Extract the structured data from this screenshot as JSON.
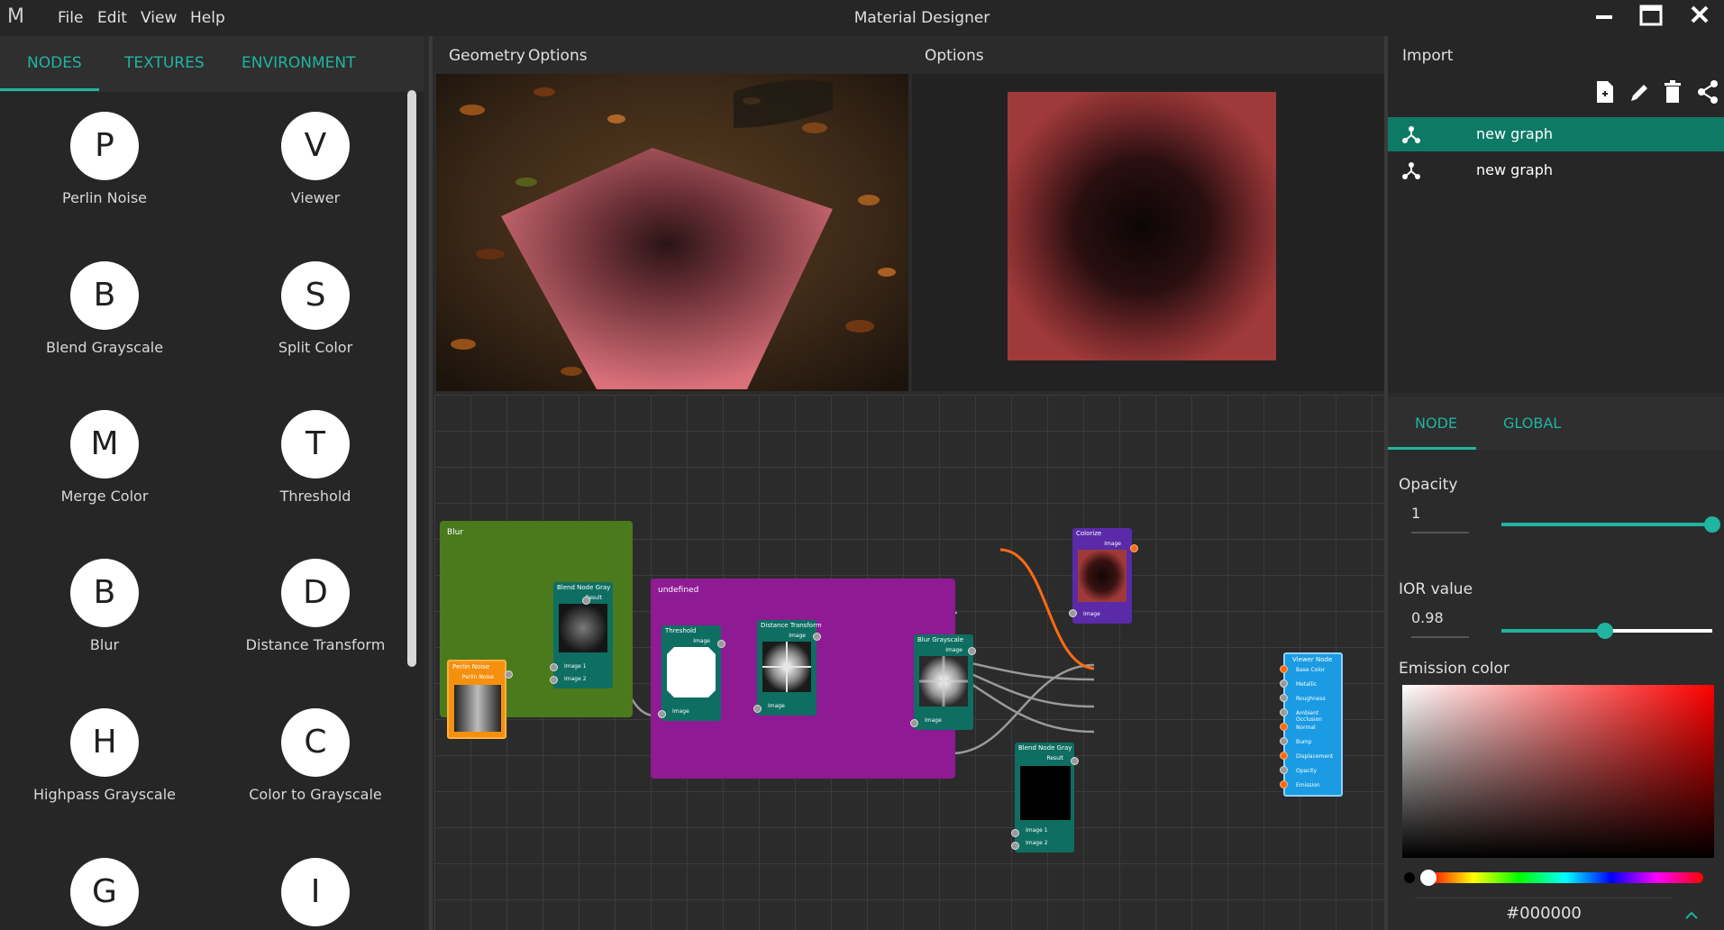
{
  "app": {
    "logo": "M",
    "title": "Material Designer"
  },
  "menu": [
    "File",
    "Edit",
    "View",
    "Help"
  ],
  "window_controls": {
    "minimize": "minimize-icon",
    "maximize": "maximize-icon",
    "close": "close-icon"
  },
  "left_tabs": [
    "NODES",
    "TEXTURES",
    "ENVIRONMENT"
  ],
  "nodes": [
    {
      "letter": "P",
      "label": "Perlin Noise"
    },
    {
      "letter": "V",
      "label": "Viewer"
    },
    {
      "letter": "B",
      "label": "Blend Grayscale"
    },
    {
      "letter": "S",
      "label": "Split Color"
    },
    {
      "letter": "M",
      "label": "Merge Color"
    },
    {
      "letter": "T",
      "label": "Threshold"
    },
    {
      "letter": "B",
      "label": "Blur"
    },
    {
      "letter": "D",
      "label": "Distance Transform"
    },
    {
      "letter": "H",
      "label": "Highpass Grayscale"
    },
    {
      "letter": "C",
      "label": "Color to Grayscale"
    },
    {
      "letter": "G",
      "label": ""
    },
    {
      "letter": "I",
      "label": ""
    }
  ],
  "view3d_bar": [
    "Geometry",
    "Options"
  ],
  "view2d_bar": [
    "Options"
  ],
  "graph": {
    "frames": [
      {
        "title": "Blur",
        "color": "#4a7a1c"
      },
      {
        "title": "undefined",
        "color": "#8e1a94"
      }
    ],
    "nodes": [
      {
        "title": "Blend Node Gray",
        "out": "Result",
        "inputs": [
          "Image 1",
          "Image 2"
        ]
      },
      {
        "title": "Perlin Noise",
        "out": "Perlin Noise",
        "inputs": []
      },
      {
        "title": "Threshold",
        "out": "Image",
        "inputs": [
          "Image"
        ]
      },
      {
        "title": "Distance Transform",
        "out": "Image",
        "inputs": [
          "Image"
        ]
      },
      {
        "title": "Blur Grayscale",
        "out": "Image",
        "inputs": [
          "Image"
        ]
      },
      {
        "title": "Colorize",
        "out": "Image",
        "inputs": [
          "Image"
        ]
      },
      {
        "title": "Blend Node Gray",
        "out": "Result",
        "inputs": [
          "Image 1",
          "Image 2"
        ]
      },
      {
        "title": "Viewer Node",
        "out": "",
        "inputs": [
          "Base Color",
          "Metallic",
          "Roughness",
          "Ambient Occlusion",
          "Normal",
          "Bump",
          "Displacement",
          "Opacity",
          "Emission"
        ]
      }
    ]
  },
  "right_top": {
    "label": "Import",
    "tools": [
      "new-file-icon",
      "edit-icon",
      "delete-icon",
      "share-icon"
    ],
    "graphs": [
      {
        "label": "new graph",
        "selected": true
      },
      {
        "label": "new graph",
        "selected": false
      }
    ]
  },
  "properties": {
    "tabs": [
      "NODE",
      "GLOBAL"
    ],
    "opacity": {
      "label": "Opacity",
      "value": "1",
      "fraction": 1.0
    },
    "ior": {
      "label": "IOR value",
      "value": "0.98",
      "fraction": 0.49
    },
    "emission": {
      "label": "Emission color",
      "hex": "#000000"
    }
  },
  "colors": {
    "accent": "#1fb5a0",
    "selection": "#0e7a66",
    "orange_link": "#ff6a13",
    "viewer_blue": "#1a9be3",
    "node_teal": "#0e6e62",
    "perlin_orange": "#f5900f",
    "colorize_purple": "#5a2aa8"
  }
}
